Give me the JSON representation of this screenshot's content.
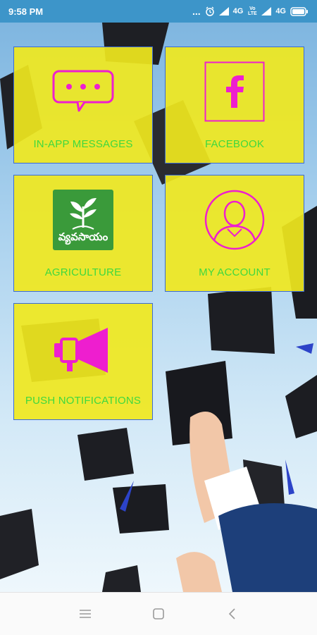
{
  "status_bar": {
    "time": "9:58 PM",
    "dots": "...",
    "network_1": "4G",
    "volte_label": "Vo LTE",
    "network_2": "4G"
  },
  "tiles": [
    {
      "label": "IN-APP MESSAGES",
      "icon": "chat-bubble-icon"
    },
    {
      "label": "FACEBOOK",
      "icon": "facebook-icon"
    },
    {
      "label": "AGRICULTURE",
      "icon": "agriculture-logo",
      "logo_text": "వ్యవసాయం"
    },
    {
      "label": "MY ACCOUNT",
      "icon": "user-account-icon"
    },
    {
      "label": "PUSH NOTIFICATIONS",
      "icon": "megaphone-icon"
    }
  ],
  "colors": {
    "tile_bg": "#f0e81e",
    "tile_border": "#3b6bd6",
    "label_green": "#3fd83f",
    "icon_magenta": "#ee1ecf",
    "status_bar": "#3d95c9"
  },
  "nav": {
    "buttons": [
      "menu-icon",
      "home-icon",
      "back-icon"
    ]
  }
}
